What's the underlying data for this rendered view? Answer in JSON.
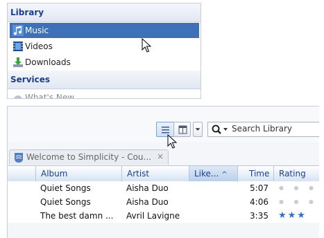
{
  "sidebar": {
    "library_header": "Library",
    "services_header": "Services",
    "items": [
      {
        "label": "Music",
        "icon": "music-note-icon",
        "selected": true
      },
      {
        "label": "Videos",
        "icon": "video-film-icon",
        "selected": false
      },
      {
        "label": "Downloads",
        "icon": "download-arrow-icon",
        "selected": false
      }
    ],
    "services_items": [
      {
        "label": "What's New",
        "icon": "globe-icon"
      }
    ]
  },
  "toolbar": {
    "list_view_icon": "list-view-icon",
    "grid_view_icon": "grid-view-icon",
    "search": {
      "placeholder": "Search Library",
      "icon": "search-icon"
    }
  },
  "tab": {
    "label": "Welcome to Simplicity - Cou...",
    "close": "×",
    "icon": "philips-logo-icon"
  },
  "table": {
    "columns": [
      "Album",
      "Artist",
      "Like...",
      "Time",
      "Rating"
    ],
    "sorted_column": "Like...",
    "sort_glyph": "^",
    "rows": [
      {
        "album": "Quiet Songs",
        "artist": "Aisha Duo",
        "time": "5:07",
        "rating": 0
      },
      {
        "album": "Quiet Songs",
        "artist": "Aisha Duo",
        "time": "4:06",
        "rating": 0
      },
      {
        "album": "The best damn ...",
        "artist": "Avril Lavigne",
        "time": "3:35",
        "rating": 3
      }
    ]
  },
  "colors": {
    "selection": "#3d72b8",
    "header_text": "#1b3f8a",
    "star_active": "#2f6fc9"
  }
}
